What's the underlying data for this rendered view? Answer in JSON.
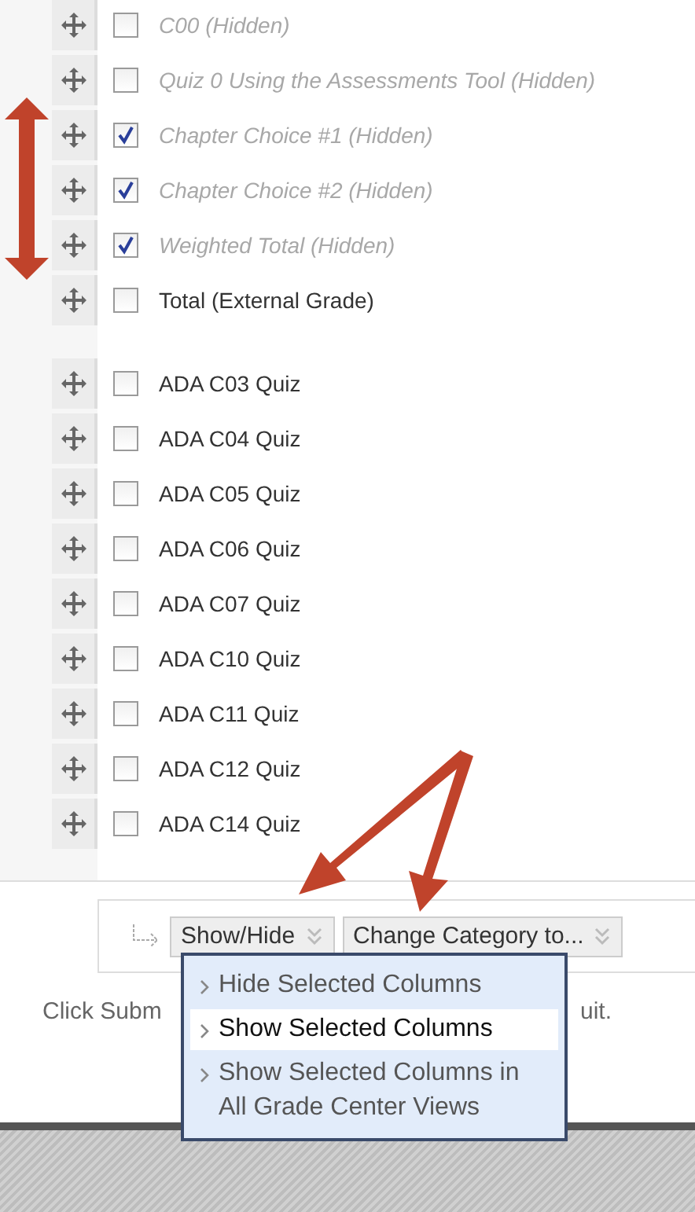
{
  "columns_top": [
    {
      "label": "C00 (Hidden)",
      "checked": false,
      "hidden": true
    },
    {
      "label": "Quiz 0 Using the Assessments Tool (Hidden)",
      "checked": false,
      "hidden": true
    },
    {
      "label": "Chapter Choice #1 (Hidden)",
      "checked": true,
      "hidden": true
    },
    {
      "label": "Chapter Choice #2 (Hidden)",
      "checked": true,
      "hidden": true
    },
    {
      "label": "Weighted Total (Hidden)",
      "checked": true,
      "hidden": true
    },
    {
      "label": "Total (External Grade)",
      "checked": false,
      "hidden": false
    }
  ],
  "columns": [
    {
      "label": "ADA C03 Quiz",
      "checked": false,
      "hidden": false
    },
    {
      "label": "ADA C04 Quiz",
      "checked": false,
      "hidden": false
    },
    {
      "label": "ADA C05 Quiz",
      "checked": false,
      "hidden": false
    },
    {
      "label": "ADA C06 Quiz",
      "checked": false,
      "hidden": false
    },
    {
      "label": "ADA C07 Quiz",
      "checked": false,
      "hidden": false
    },
    {
      "label": "ADA C10 Quiz",
      "checked": false,
      "hidden": false
    },
    {
      "label": "ADA C11 Quiz",
      "checked": false,
      "hidden": false
    },
    {
      "label": "ADA C12 Quiz",
      "checked": false,
      "hidden": false
    },
    {
      "label": "ADA C14 Quiz",
      "checked": false,
      "hidden": false
    }
  ],
  "toolbar": {
    "buttons": [
      "Show/Hide",
      "Change Category to..."
    ]
  },
  "menu": {
    "items": [
      {
        "label": "Hide Selected Columns",
        "selected": false
      },
      {
        "label": "Show Selected Columns",
        "selected": true
      },
      {
        "label": "Show Selected Columns in All Grade Center Views",
        "selected": false
      }
    ]
  },
  "instruction": {
    "before": "Click Subm",
    "after": "uit."
  }
}
